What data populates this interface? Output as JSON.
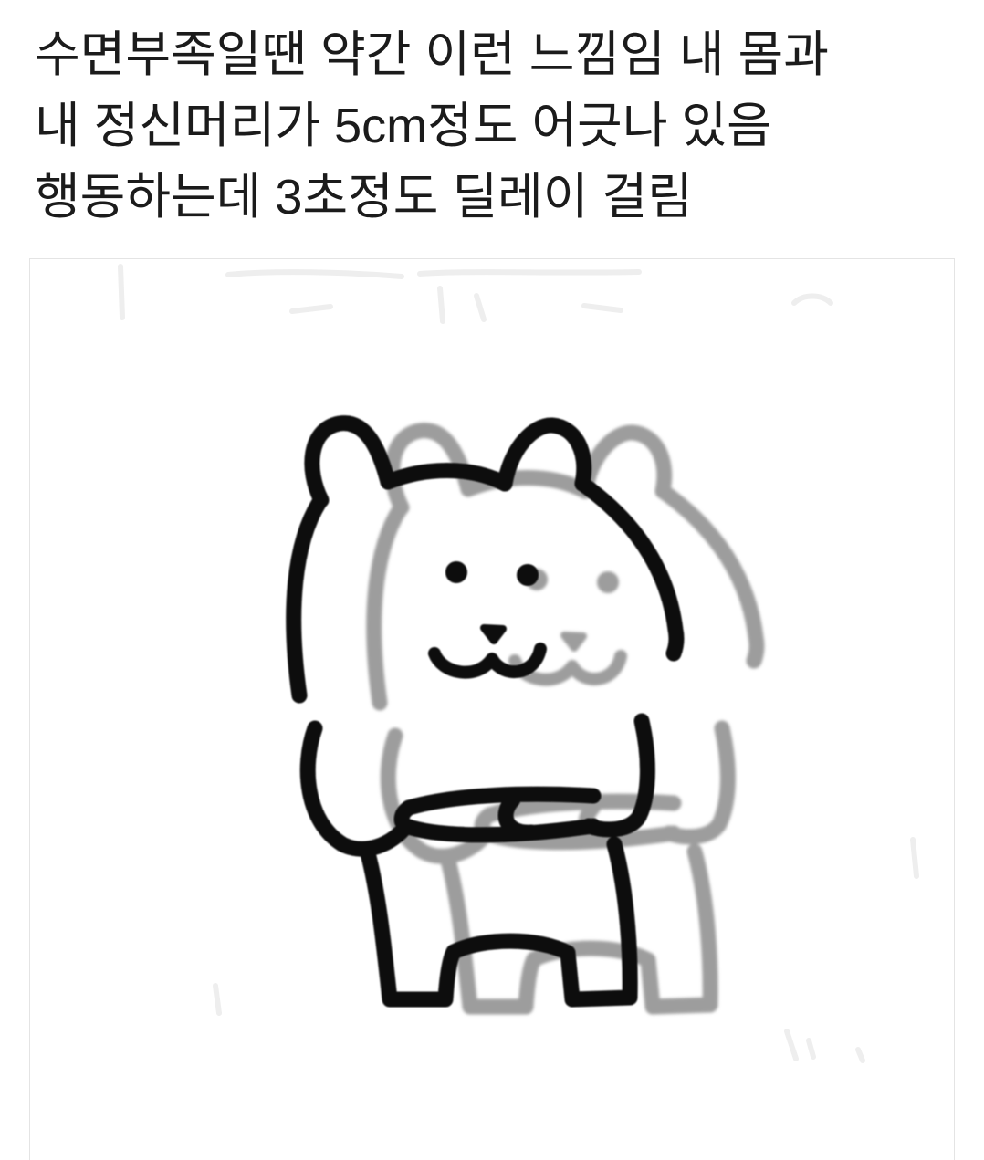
{
  "post": {
    "text_lines": [
      "수면부족일땐 약간 이런 느낌임 내 몸과",
      "내 정신머리가 5cm정도 어긋나 있음",
      "행동하는데 3초정도 딜레이 걸림"
    ]
  },
  "colors": {
    "text": "#1b1b1b",
    "ink": "#0b0b0b",
    "ghost": "#9d9d9d",
    "frame": "#e4e4e4",
    "smudge": "#eeeeee"
  }
}
